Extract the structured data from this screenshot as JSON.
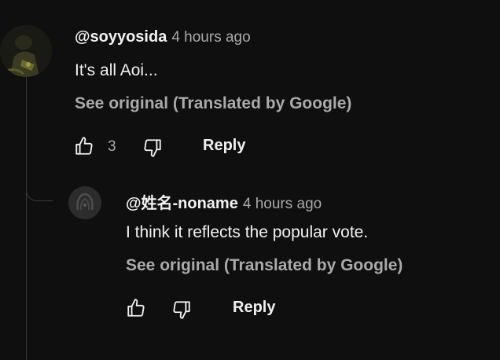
{
  "comment": {
    "author": "@soyyosida",
    "time": "4 hours ago",
    "text": "It's all Aoi...",
    "see_original": "See original (Translated by Google)",
    "like_count": "3",
    "reply_label": "Reply"
  },
  "reply": {
    "author": "@姓名-noname",
    "time": "4 hours ago",
    "text": "I think it reflects the popular vote.",
    "see_original": "See original (Translated by Google)",
    "reply_label": "Reply"
  },
  "icons": {
    "like": "thumbs-up-icon",
    "dislike": "thumbs-down-icon"
  },
  "colors": {
    "background": "#0f0f0f",
    "primary_text": "#f1f1f1",
    "secondary_text": "#aaaaaa"
  }
}
